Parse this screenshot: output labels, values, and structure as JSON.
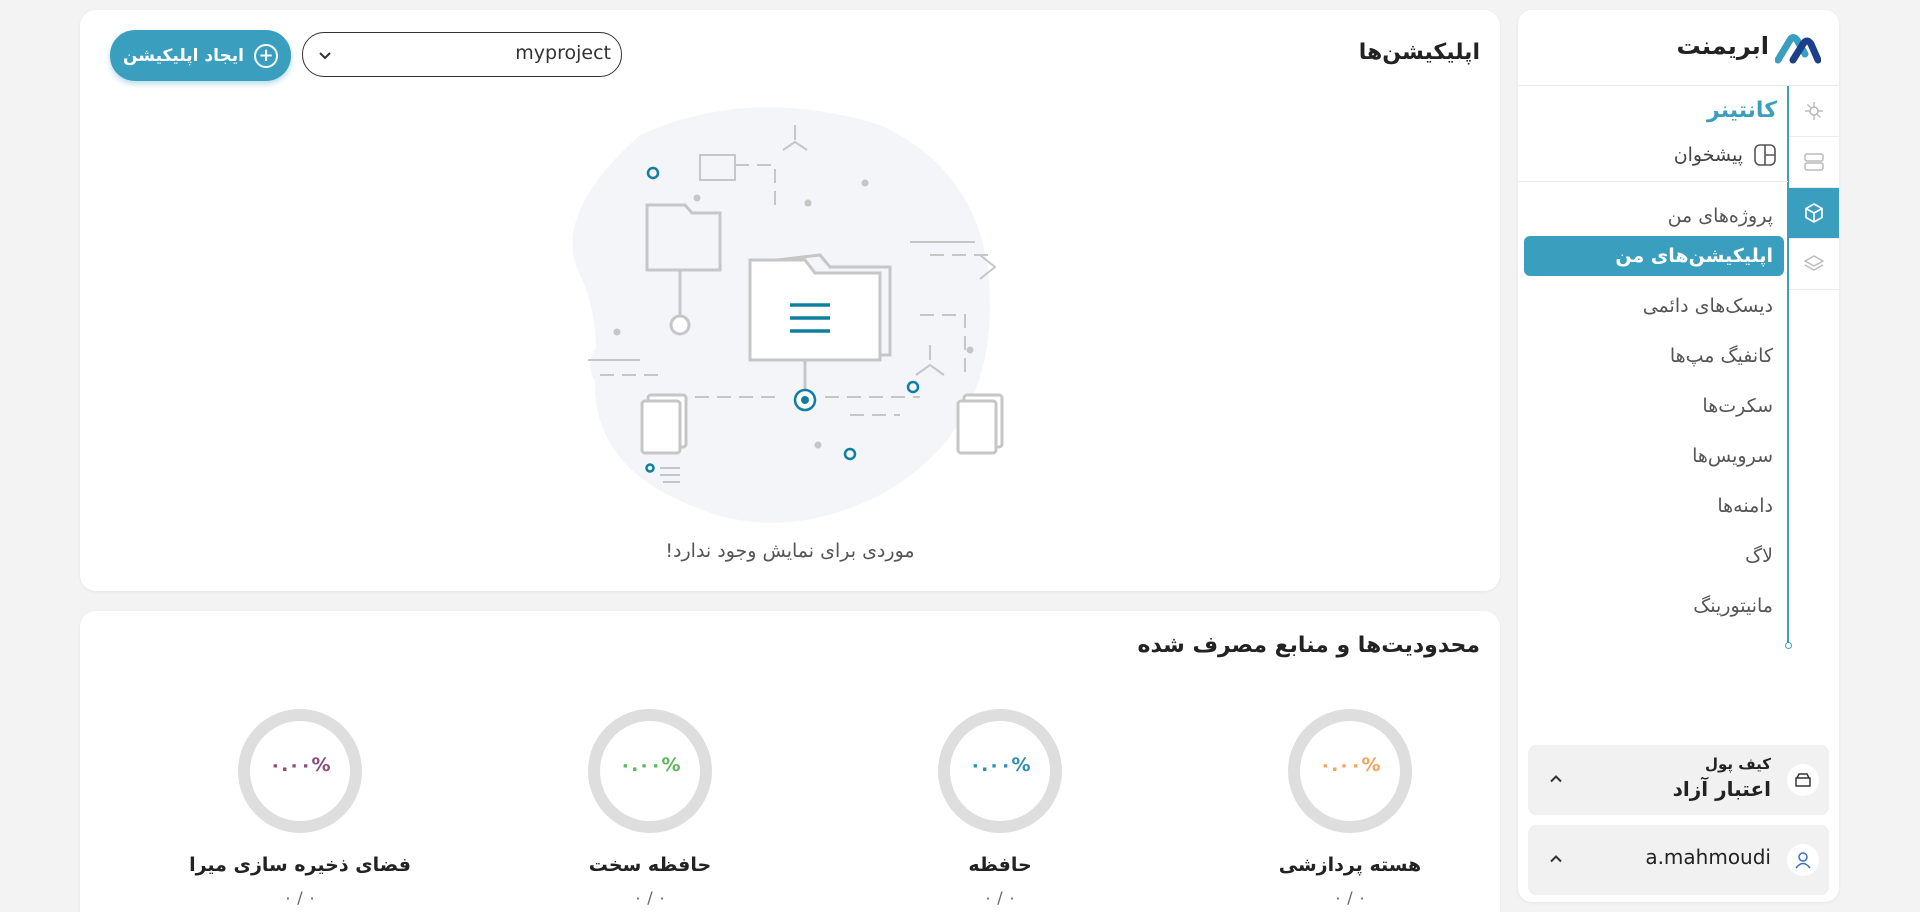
{
  "brand": {
    "name": "ابریمنت",
    "accent": "#3a9fbf"
  },
  "sidebar": {
    "rail_icons": [
      "kubernetes-icon",
      "server-icon",
      "container-icon",
      "layers-icon"
    ],
    "section_title": "کانتینر",
    "sub_item": {
      "label": "پیشخوان",
      "icon": "dashboard-icon"
    },
    "items": [
      {
        "label": "پروژه‌های من",
        "active": false
      },
      {
        "label": "اپلیکیشن‌های من",
        "active": true
      },
      {
        "label": "دیسک‌های دائمی",
        "active": false
      },
      {
        "label": "کانفیگ مپ‌ها",
        "active": false
      },
      {
        "label": "سکرت‌ها",
        "active": false
      },
      {
        "label": "سرویس‌ها",
        "active": false
      },
      {
        "label": "دامنه‌ها",
        "active": false
      },
      {
        "label": "لاگ",
        "active": false
      },
      {
        "label": "مانیتورینگ",
        "active": false
      }
    ],
    "wallet": {
      "title": "کیف پول",
      "value": "اعتبار آزاد"
    },
    "user": {
      "name": "a.mahmoudi"
    }
  },
  "apps": {
    "title": "اپلیکیشن‌ها",
    "project_select": {
      "value": "myproject"
    },
    "create_button": "ایجاد اپلیکیشن",
    "empty_text": "موردی برای نمایش وجود ندارد!"
  },
  "limits": {
    "title": "محدودیت‌ها و منابع مصرف شده",
    "gauges": [
      {
        "label": "هسته پردازشی",
        "percent": "۰.۰۰%",
        "color": "#f2a65a",
        "sub": "۰ / ۰"
      },
      {
        "label": "حافظه",
        "percent": "۰.۰۰%",
        "color": "#2a8fb0",
        "sub": "۰ / ۰"
      },
      {
        "label": "حافظه سخت",
        "percent": "۰.۰۰%",
        "color": "#5cb85c",
        "sub": "۰ / ۰"
      },
      {
        "label": "فضای ذخیره سازی میرا",
        "percent": "۰.۰۰%",
        "color": "#8e4a7a",
        "sub": "۰ / ۰"
      }
    ]
  }
}
